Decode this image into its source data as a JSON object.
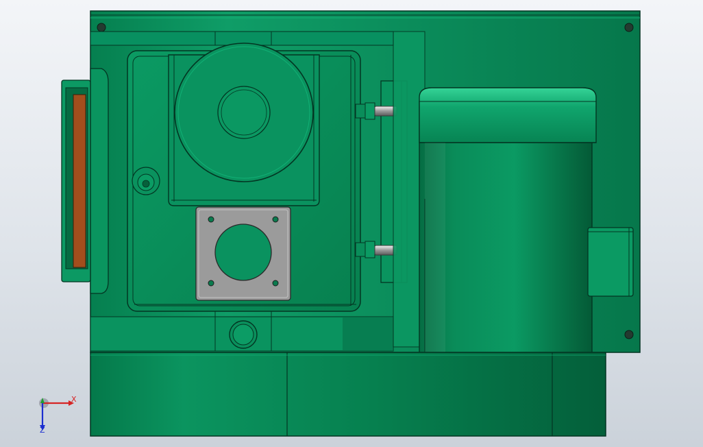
{
  "triad": {
    "x_label": "X",
    "z_label": "Z"
  },
  "colors": {
    "body_green": "#069160",
    "dark_green": "#05683f",
    "light_green": "#19b27a",
    "flange_grey": "#9a9a9a",
    "gasket_brown": "#a24e1d",
    "axis_x": "#d62424",
    "axis_y": "#1f9f32",
    "axis_z": "#1b2ed0"
  }
}
